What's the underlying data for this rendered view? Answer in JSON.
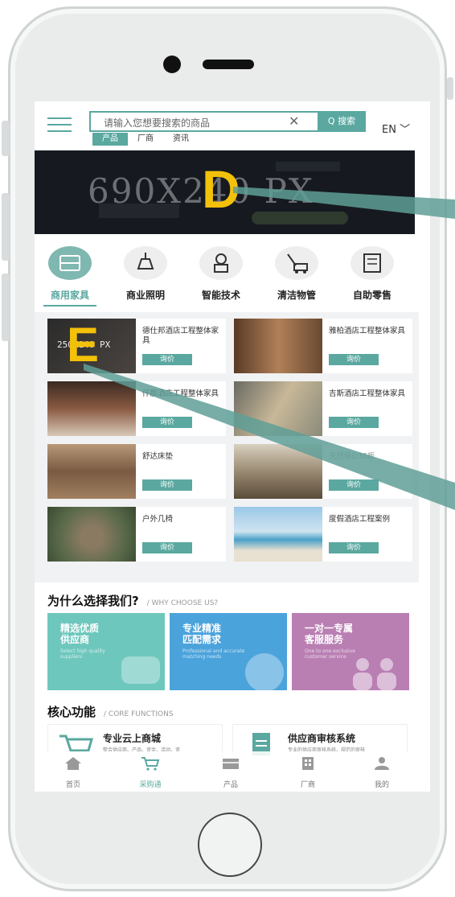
{
  "header": {
    "search_placeholder": "请输入您想要搜索的商品",
    "clear": "✕",
    "search_button": "Q 搜索",
    "lang": "EN ﹀",
    "tabs": [
      {
        "label": "产品"
      },
      {
        "label": "厂商"
      },
      {
        "label": "资讯"
      }
    ]
  },
  "banner": {
    "placeholder": "690X240 PX",
    "marker": "D"
  },
  "categories": [
    {
      "label": "商用家具",
      "icon": "sofa-icon"
    },
    {
      "label": "商业照明",
      "icon": "lamp-icon"
    },
    {
      "label": "智能技术",
      "icon": "robot-icon"
    },
    {
      "label": "清洁物管",
      "icon": "mower-icon"
    },
    {
      "label": "自助零售",
      "icon": "vending-icon"
    }
  ],
  "products": [
    {
      "name": "德仕邦酒店工程整体家具",
      "button": "询价",
      "thumb_text": "250X140 PX"
    },
    {
      "name": "雅柏酒店工程整体家具",
      "button": "询价"
    },
    {
      "name": "仟那酒店工程整体家具",
      "button": "询价"
    },
    {
      "name": "吉斯酒店工程整体家具",
      "button": "询价"
    },
    {
      "name": "舒达床垫",
      "button": "询价"
    },
    {
      "name": "天然级D38板",
      "button": "询价"
    },
    {
      "name": "户外几椅",
      "button": "询价"
    },
    {
      "name": "度假酒店工程案例",
      "button": "询价"
    }
  ],
  "product_marker": "E",
  "why": {
    "title": "为什么选择我们?",
    "subtitle": "/ WHY CHOOSE US?",
    "cards": [
      {
        "title": "精选优质\n供应商",
        "sub": "Select high quality suppliers",
        "color": "#6ec7bd"
      },
      {
        "title": "专业精准\n匹配需求",
        "sub": "Professional and accurate matching needs",
        "color": "#4ba3dc"
      },
      {
        "title": "一对一专属\n客服服务",
        "sub": "One to one exclusive customer service",
        "color": "#b97fb3"
      }
    ]
  },
  "core": {
    "title": "核心功能",
    "subtitle": "/ CORE FUNCTIONS",
    "items": [
      {
        "title": "专业云上商城",
        "sub": "整合供应商、产品、资金、活动、资",
        "icon": "cart-icon"
      },
      {
        "title": "供应商审核系统",
        "sub": "专业的供应商审核系统，规范的审核",
        "icon": "document-icon"
      }
    ]
  },
  "tabbar": [
    {
      "label": "首页",
      "icon": "home-icon"
    },
    {
      "label": "采购通",
      "icon": "cart-icon"
    },
    {
      "label": "产品",
      "icon": "box-icon"
    },
    {
      "label": "厂商",
      "icon": "building-icon"
    },
    {
      "label": "我的",
      "icon": "user-icon"
    }
  ],
  "colors": {
    "accent": "#5aa8a0",
    "banner": "#161a20"
  }
}
